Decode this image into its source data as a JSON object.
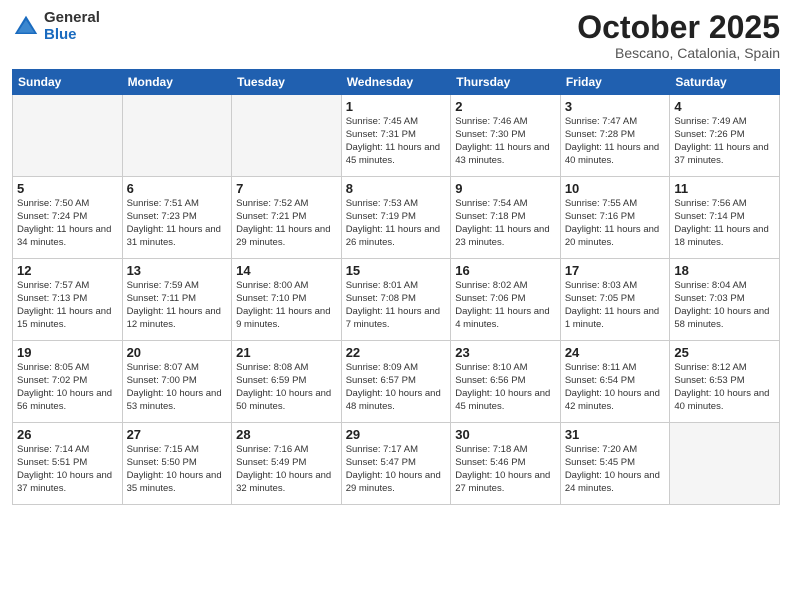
{
  "header": {
    "logo_general": "General",
    "logo_blue": "Blue",
    "month_title": "October 2025",
    "location": "Bescano, Catalonia, Spain"
  },
  "weekdays": [
    "Sunday",
    "Monday",
    "Tuesday",
    "Wednesday",
    "Thursday",
    "Friday",
    "Saturday"
  ],
  "weeks": [
    [
      {
        "day": "",
        "info": ""
      },
      {
        "day": "",
        "info": ""
      },
      {
        "day": "",
        "info": ""
      },
      {
        "day": "1",
        "info": "Sunrise: 7:45 AM\nSunset: 7:31 PM\nDaylight: 11 hours\nand 45 minutes."
      },
      {
        "day": "2",
        "info": "Sunrise: 7:46 AM\nSunset: 7:30 PM\nDaylight: 11 hours\nand 43 minutes."
      },
      {
        "day": "3",
        "info": "Sunrise: 7:47 AM\nSunset: 7:28 PM\nDaylight: 11 hours\nand 40 minutes."
      },
      {
        "day": "4",
        "info": "Sunrise: 7:49 AM\nSunset: 7:26 PM\nDaylight: 11 hours\nand 37 minutes."
      }
    ],
    [
      {
        "day": "5",
        "info": "Sunrise: 7:50 AM\nSunset: 7:24 PM\nDaylight: 11 hours\nand 34 minutes."
      },
      {
        "day": "6",
        "info": "Sunrise: 7:51 AM\nSunset: 7:23 PM\nDaylight: 11 hours\nand 31 minutes."
      },
      {
        "day": "7",
        "info": "Sunrise: 7:52 AM\nSunset: 7:21 PM\nDaylight: 11 hours\nand 29 minutes."
      },
      {
        "day": "8",
        "info": "Sunrise: 7:53 AM\nSunset: 7:19 PM\nDaylight: 11 hours\nand 26 minutes."
      },
      {
        "day": "9",
        "info": "Sunrise: 7:54 AM\nSunset: 7:18 PM\nDaylight: 11 hours\nand 23 minutes."
      },
      {
        "day": "10",
        "info": "Sunrise: 7:55 AM\nSunset: 7:16 PM\nDaylight: 11 hours\nand 20 minutes."
      },
      {
        "day": "11",
        "info": "Sunrise: 7:56 AM\nSunset: 7:14 PM\nDaylight: 11 hours\nand 18 minutes."
      }
    ],
    [
      {
        "day": "12",
        "info": "Sunrise: 7:57 AM\nSunset: 7:13 PM\nDaylight: 11 hours\nand 15 minutes."
      },
      {
        "day": "13",
        "info": "Sunrise: 7:59 AM\nSunset: 7:11 PM\nDaylight: 11 hours\nand 12 minutes."
      },
      {
        "day": "14",
        "info": "Sunrise: 8:00 AM\nSunset: 7:10 PM\nDaylight: 11 hours\nand 9 minutes."
      },
      {
        "day": "15",
        "info": "Sunrise: 8:01 AM\nSunset: 7:08 PM\nDaylight: 11 hours\nand 7 minutes."
      },
      {
        "day": "16",
        "info": "Sunrise: 8:02 AM\nSunset: 7:06 PM\nDaylight: 11 hours\nand 4 minutes."
      },
      {
        "day": "17",
        "info": "Sunrise: 8:03 AM\nSunset: 7:05 PM\nDaylight: 11 hours\nand 1 minute."
      },
      {
        "day": "18",
        "info": "Sunrise: 8:04 AM\nSunset: 7:03 PM\nDaylight: 10 hours\nand 58 minutes."
      }
    ],
    [
      {
        "day": "19",
        "info": "Sunrise: 8:05 AM\nSunset: 7:02 PM\nDaylight: 10 hours\nand 56 minutes."
      },
      {
        "day": "20",
        "info": "Sunrise: 8:07 AM\nSunset: 7:00 PM\nDaylight: 10 hours\nand 53 minutes."
      },
      {
        "day": "21",
        "info": "Sunrise: 8:08 AM\nSunset: 6:59 PM\nDaylight: 10 hours\nand 50 minutes."
      },
      {
        "day": "22",
        "info": "Sunrise: 8:09 AM\nSunset: 6:57 PM\nDaylight: 10 hours\nand 48 minutes."
      },
      {
        "day": "23",
        "info": "Sunrise: 8:10 AM\nSunset: 6:56 PM\nDaylight: 10 hours\nand 45 minutes."
      },
      {
        "day": "24",
        "info": "Sunrise: 8:11 AM\nSunset: 6:54 PM\nDaylight: 10 hours\nand 42 minutes."
      },
      {
        "day": "25",
        "info": "Sunrise: 8:12 AM\nSunset: 6:53 PM\nDaylight: 10 hours\nand 40 minutes."
      }
    ],
    [
      {
        "day": "26",
        "info": "Sunrise: 7:14 AM\nSunset: 5:51 PM\nDaylight: 10 hours\nand 37 minutes."
      },
      {
        "day": "27",
        "info": "Sunrise: 7:15 AM\nSunset: 5:50 PM\nDaylight: 10 hours\nand 35 minutes."
      },
      {
        "day": "28",
        "info": "Sunrise: 7:16 AM\nSunset: 5:49 PM\nDaylight: 10 hours\nand 32 minutes."
      },
      {
        "day": "29",
        "info": "Sunrise: 7:17 AM\nSunset: 5:47 PM\nDaylight: 10 hours\nand 29 minutes."
      },
      {
        "day": "30",
        "info": "Sunrise: 7:18 AM\nSunset: 5:46 PM\nDaylight: 10 hours\nand 27 minutes."
      },
      {
        "day": "31",
        "info": "Sunrise: 7:20 AM\nSunset: 5:45 PM\nDaylight: 10 hours\nand 24 minutes."
      },
      {
        "day": "",
        "info": ""
      }
    ]
  ]
}
